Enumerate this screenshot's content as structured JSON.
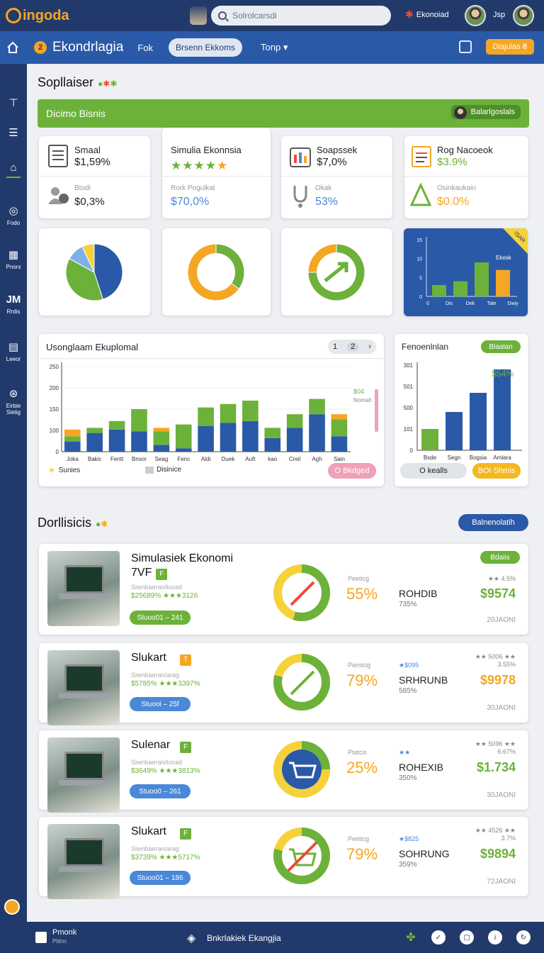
{
  "topbar": {
    "logo": "ingoda",
    "search_placeholder": "Solrolcarsdi",
    "user_label": "Ekonoiad",
    "user_name": "Jsp"
  },
  "navbar": {
    "brand": "Ekondrlagia",
    "link1": "Fok",
    "pill": "Brsenn Ekkoms",
    "dropdown": "Tonp",
    "button": "Diajulas"
  },
  "sidebar": {
    "items": [
      {
        "icon": "layout-icon",
        "label": ""
      },
      {
        "icon": "list-icon",
        "label": ""
      },
      {
        "icon": "home-icon",
        "label": ""
      },
      {
        "icon": "goggles-icon",
        "label": "Fodo"
      },
      {
        "icon": "grid-icon",
        "label": "Pnors"
      },
      {
        "icon": "text-icon",
        "label": "Rrdis",
        "glyph": "JM"
      },
      {
        "icon": "doc-icon",
        "label": "Leeor"
      },
      {
        "icon": "compass-icon",
        "label": "Eirbie Sietig"
      }
    ]
  },
  "section1": {
    "title": "Sopllaiser"
  },
  "banner": {
    "title": "Dicimo Bisnis",
    "pill": "Balarlgoslals"
  },
  "kpis": [
    {
      "label": "Smaal",
      "value": "$1,59%",
      "sub_label": "Btodi",
      "sub_value": "$0,3%"
    },
    {
      "label": "Simulia Ekonnsia",
      "stars": 5,
      "sub_label": "Rork Pogulkal",
      "sub_value": "$70,0%"
    },
    {
      "label": "Soapssek",
      "value": "$7,0%",
      "sub_label": "Okak",
      "sub_value": "53%"
    },
    {
      "label": "Rog Nacoeok",
      "value": "$3.9%",
      "sub_label": "Osinkaukain",
      "sub_value": "$0.0%"
    }
  ],
  "mini_chart": {
    "ticks": [
      "0",
      "5",
      "10",
      "15"
    ],
    "x_labels": [
      "0",
      "Dis",
      "Dek",
      "Tale",
      "Dwiy"
    ],
    "annotation": "Ekesk",
    "values": [
      3,
      4,
      9,
      7
    ],
    "corner": "ISAR"
  },
  "chart_data": [
    {
      "type": "bar",
      "title": "Usonglaam Ekuplomal",
      "categories": [
        "Joka",
        "Bakic",
        "Fentt",
        "Bnsor",
        "Seag",
        "Fenc",
        "Aldi",
        "Duek",
        "Auft",
        "kao",
        "Creil",
        "Agh",
        "Sain"
      ],
      "series": [
        {
          "name": "Sunies",
          "color": "#2a59a8",
          "values": [
            30,
            55,
            65,
            60,
            20,
            10,
            75,
            85,
            90,
            40,
            70,
            110,
            45
          ]
        },
        {
          "name": "Disinice",
          "color": "#6cb23a",
          "values": [
            15,
            15,
            25,
            65,
            40,
            70,
            55,
            55,
            60,
            30,
            40,
            45,
            50
          ]
        },
        {
          "name": "",
          "color": "#f5a623",
          "values": [
            20,
            0,
            0,
            0,
            10,
            0,
            0,
            0,
            0,
            0,
            0,
            0,
            15
          ]
        }
      ],
      "ylim": [
        0,
        250
      ],
      "yticks": [
        "0",
        "100",
        "150",
        "200",
        "250"
      ],
      "legend": [
        "Sunies",
        "Disinice"
      ],
      "annotation": [
        "$04",
        "Nomah"
      ],
      "page": [
        "1",
        "2"
      ],
      "pill": "O Bkdged"
    },
    {
      "type": "bar",
      "title": "Fenoenlnlan",
      "categories": [
        "Bsde",
        "Segn",
        "Bogsia",
        "Amlara"
      ],
      "values": [
        100,
        180,
        270,
        380
      ],
      "ylim": [
        0,
        400
      ],
      "yticks": [
        "0",
        "101",
        "500",
        "501",
        "301"
      ],
      "annotation": "$54%",
      "badge": "Blaalan",
      "pill_left": "O kealls",
      "pill_right": "BOI Shmis"
    },
    {
      "type": "pie",
      "values": [
        45,
        38,
        10,
        7
      ],
      "colors": [
        "#2a59a8",
        "#6cb23a",
        "#7fb0e8",
        "#f5d23a"
      ]
    },
    {
      "type": "pie",
      "values": [
        35,
        65
      ],
      "colors": [
        "#6cb23a",
        "#f5a623"
      ]
    },
    {
      "type": "pie",
      "values": [
        75,
        25
      ],
      "colors": [
        "#6cb23a",
        "#f5a623"
      ]
    }
  ],
  "section2": {
    "title": "Dorllisicis",
    "button": "Balnenolatih"
  },
  "list": [
    {
      "title": "Simulasiek Ekonomi",
      "title2": "7VF",
      "badge": "F",
      "badge_color": "#6cb23a",
      "sub": "Siwnbaeran/kxrad",
      "meta": "$25689% ★★★3126",
      "pill": "Stuoo01 – 241",
      "pill_color": "#6cb23a",
      "p_label": "Peeticg",
      "pct": "55%",
      "code": "ROHDIB",
      "code_sub": "735%",
      "stars": "★★ 4.5%",
      "price": "$9574",
      "price_color": "#6cb23a",
      "foot": "20JAONI",
      "tag": "Bdaiis"
    },
    {
      "title": "Slukart",
      "title2": "",
      "badge": "T",
      "badge_color": "#f5a623",
      "sub": "Siwnbaeran/arag",
      "meta": "$5785% ★★★3397%",
      "pill": "Stuooi – 25f",
      "pill_color": "#4a88d8",
      "p_label": "Pientcig",
      "pct": "79%",
      "code": "SRHRUNB",
      "code_sub": "585%",
      "stars": "★★ 5006 ★★ 3.55%",
      "star_left": "★$095",
      "price": "$9978",
      "price_color": "#f5a623",
      "foot": "30JAONI",
      "tag": ""
    },
    {
      "title": "Sulenar",
      "title2": "",
      "badge": "F",
      "badge_color": "#6cb23a",
      "sub": "Siwnbaeran/kxrad",
      "meta": "$3649% ★★★3813%",
      "pill": "Stuoo0 – 261",
      "pill_color": "#4a88d8",
      "p_label": "Ptatcis",
      "pct": "25%",
      "code": "ROHEXIB",
      "code_sub": "350%",
      "stars": "★★ 5096 ★★ 6.67%",
      "star_left": "★★",
      "price": "$1.734",
      "price_color": "#6cb23a",
      "foot": "30JAONI",
      "tag": ""
    },
    {
      "title": "Slukart",
      "title2": "",
      "badge": "F",
      "badge_color": "#6cb23a",
      "sub": "Siwnbaeran/arag",
      "meta": "$3739% ★★★5717%",
      "pill": "Stuoo01 – 186",
      "pill_color": "#4a88d8",
      "p_label": "Peeticg",
      "pct": "79%",
      "code": "SOHRUNG",
      "code_sub": "359%",
      "stars": "★★ 4526 ★★ 3.7%",
      "star_left": "★$825",
      "price": "$9894",
      "price_color": "#6cb23a",
      "foot": "72JAONI",
      "tag": ""
    }
  ],
  "bottombar": {
    "left_label": "Pmonk",
    "left_sub": "Pbtnc",
    "center": "Bnkrlakiek Ekangjia"
  }
}
